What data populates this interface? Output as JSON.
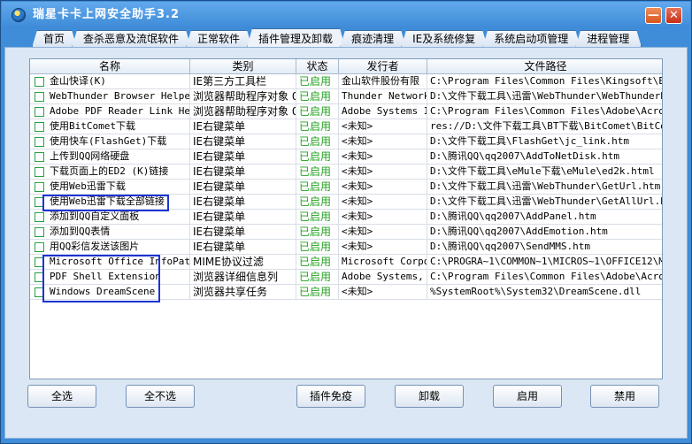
{
  "window": {
    "title": "瑞星卡卡上网安全助手3.2",
    "minimize_glyph": "—",
    "close_glyph": "✕",
    "logo_icon": "rising-kaka-logo-icon"
  },
  "tabs": [
    {
      "label": "首页",
      "active": false
    },
    {
      "label": "查杀恶意及流氓软件",
      "active": false
    },
    {
      "label": "正常软件",
      "active": false
    },
    {
      "label": "插件管理及卸载",
      "active": true
    },
    {
      "label": "痕迹清理",
      "active": false
    },
    {
      "label": "IE及系统修复",
      "active": false
    },
    {
      "label": "系统启动项管理",
      "active": false
    },
    {
      "label": "进程管理",
      "active": false
    }
  ],
  "table": {
    "columns": {
      "name": "名称",
      "type": "类别",
      "status": "状态",
      "publisher": "发行者",
      "path": "文件路径"
    },
    "rows": [
      {
        "name": "金山快译(K)",
        "type": "IE第三方工具栏",
        "status": "已启用",
        "publisher": "金山软件股份有限",
        "path": "C:\\Program Files\\Common Files\\Kingsoft\\Extr"
      },
      {
        "name": "WebThunder Browser Helper",
        "type": "浏览器帮助程序对象 0",
        "status": "已启用",
        "publisher": "Thunder Networki",
        "path": "D:\\文件下载工具\\迅雷\\WebThunder\\WebThunderE"
      },
      {
        "name": "Adobe PDF Reader Link Help",
        "type": "浏览器帮助程序对象 0",
        "status": "已启用",
        "publisher": "Adobe Systems In",
        "path": "C:\\Program Files\\Common Files\\Adobe\\Acrobat"
      },
      {
        "name": "使用BitComet下载",
        "type": "IE右键菜单",
        "status": "已启用",
        "publisher": "<未知>",
        "path": "res://D:\\文件下载工具\\BT下载\\BitComet\\BitCo"
      },
      {
        "name": "使用快车(FlashGet)下载",
        "type": "IE右键菜单",
        "status": "已启用",
        "publisher": "<未知>",
        "path": "D:\\文件下载工具\\FlashGet\\jc_link.htm"
      },
      {
        "name": "上传到QQ网络硬盘",
        "type": "IE右键菜单",
        "status": "已启用",
        "publisher": "<未知>",
        "path": "D:\\腾讯QQ\\qq2007\\AddToNetDisk.htm"
      },
      {
        "name": "下载页面上的ED2 (K)链接",
        "type": "IE右键菜单",
        "status": "已启用",
        "publisher": "<未知>",
        "path": "D:\\文件下载工具\\eMule下载\\eMule\\ed2k.html"
      },
      {
        "name": "使用Web迅雷下载",
        "type": "IE右键菜单",
        "status": "已启用",
        "publisher": "<未知>",
        "path": "D:\\文件下载工具\\迅雷\\WebThunder\\GetUrl.htm"
      },
      {
        "name": "使用Web迅雷下载全部链接",
        "type": "IE右键菜单",
        "status": "已启用",
        "publisher": "<未知>",
        "path": "D:\\文件下载工具\\迅雷\\WebThunder\\GetAllUrl.h"
      },
      {
        "name": "添加到QQ自定义面板",
        "type": "IE右键菜单",
        "status": "已启用",
        "publisher": "<未知>",
        "path": "D:\\腾讯QQ\\qq2007\\AddPanel.htm"
      },
      {
        "name": "添加到QQ表情",
        "type": "IE右键菜单",
        "status": "已启用",
        "publisher": "<未知>",
        "path": "D:\\腾讯QQ\\qq2007\\AddEmotion.htm"
      },
      {
        "name": "用QQ彩信发送该图片",
        "type": "IE右键菜单",
        "status": "已启用",
        "publisher": "<未知>",
        "path": "D:\\腾讯QQ\\qq2007\\SendMMS.htm"
      },
      {
        "name": "Microsoft Office InfoPath",
        "type": "MIME协议过滤",
        "status": "已启用",
        "publisher": "Microsoft Corpor",
        "path": "C:\\PROGRA~1\\COMMON~1\\MICROS~1\\OFFICE12\\MSOX"
      },
      {
        "name": "PDF Shell Extension",
        "type": "浏览器详细信息列",
        "status": "已启用",
        "publisher": "Adobe Systems, I",
        "path": "C:\\Program Files\\Common Files\\Adobe\\Acrobat"
      },
      {
        "name": "Windows DreamScene",
        "type": "浏览器共享任务",
        "status": "已启用",
        "publisher": "<未知>",
        "path": "%SystemRoot%\\System32\\DreamScene.dll"
      }
    ]
  },
  "buttons": {
    "select_all": "全选",
    "select_none": "全不选",
    "immunize": "插件免疫",
    "uninstall": "卸载",
    "enable": "启用",
    "disable": "禁用"
  },
  "colors": {
    "window_blue": "#3f8cd9",
    "status_green": "#22a11f",
    "highlight_box": "#1d33d4"
  }
}
